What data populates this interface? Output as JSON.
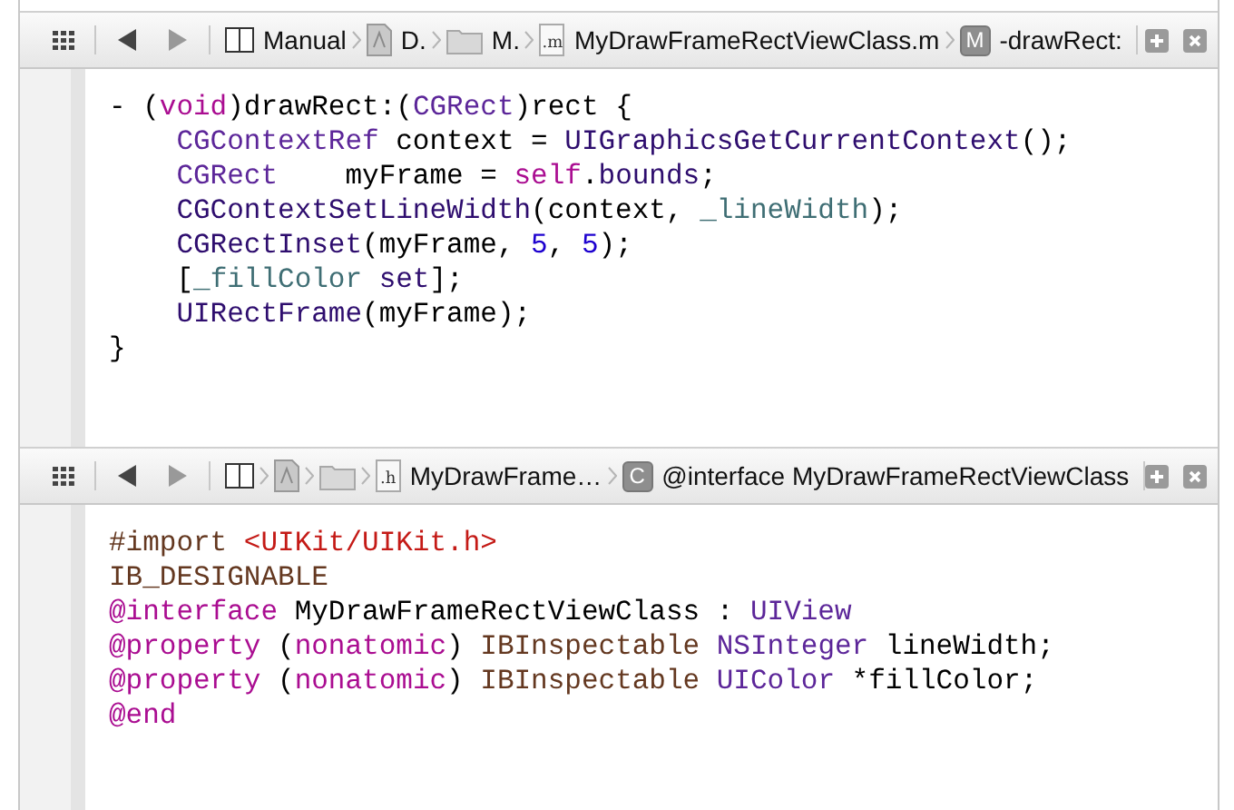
{
  "panes": [
    {
      "jump_bar": {
        "crumbs": [
          {
            "kind": "layout",
            "label": "Manual"
          },
          {
            "kind": "project",
            "label": "D."
          },
          {
            "kind": "folder",
            "label": "M."
          },
          {
            "kind": "file",
            "badge": ".m",
            "label": "MyDrawFrameRectViewClass.m"
          },
          {
            "kind": "symbol",
            "badge": "M",
            "label": "-drawRect:"
          }
        ]
      },
      "code": [
        [
          {
            "kind": "plain",
            "text": "- ("
          },
          {
            "kind": "keyword",
            "text": "void"
          },
          {
            "kind": "plain",
            "text": ")drawRect:("
          },
          {
            "kind": "type",
            "text": "CGRect"
          },
          {
            "kind": "plain",
            "text": ")rect {"
          }
        ],
        [
          {
            "kind": "type",
            "text": "    CGContextRef"
          },
          {
            "kind": "plain",
            "text": " context = "
          },
          {
            "kind": "func",
            "text": "UIGraphicsGetCurrentContext"
          },
          {
            "kind": "plain",
            "text": "();"
          }
        ],
        [
          {
            "kind": "type",
            "text": "    CGRect"
          },
          {
            "kind": "plain",
            "text": "    myFrame = "
          },
          {
            "kind": "keyword",
            "text": "self"
          },
          {
            "kind": "plain",
            "text": "."
          },
          {
            "kind": "func",
            "text": "bounds"
          },
          {
            "kind": "plain",
            "text": ";"
          }
        ],
        [
          {
            "kind": "func",
            "text": "    CGContextSetLineWidth"
          },
          {
            "kind": "plain",
            "text": "(context, "
          },
          {
            "kind": "ivar",
            "text": "_lineWidth"
          },
          {
            "kind": "plain",
            "text": ");"
          }
        ],
        [
          {
            "kind": "func",
            "text": "    CGRectInset"
          },
          {
            "kind": "plain",
            "text": "(myFrame, "
          },
          {
            "kind": "number",
            "text": "5"
          },
          {
            "kind": "plain",
            "text": ", "
          },
          {
            "kind": "number",
            "text": "5"
          },
          {
            "kind": "plain",
            "text": ");"
          }
        ],
        [
          {
            "kind": "plain",
            "text": "    ["
          },
          {
            "kind": "ivar",
            "text": "_fillColor"
          },
          {
            "kind": "func",
            "text": " set"
          },
          {
            "kind": "plain",
            "text": "];"
          }
        ],
        [
          {
            "kind": "func",
            "text": "    UIRectFrame"
          },
          {
            "kind": "plain",
            "text": "(myFrame);"
          }
        ],
        [
          {
            "kind": "plain",
            "text": "}"
          }
        ]
      ]
    },
    {
      "jump_bar": {
        "crumbs": [
          {
            "kind": "layout"
          },
          {
            "kind": "project"
          },
          {
            "kind": "folder"
          },
          {
            "kind": "file",
            "badge": ".h",
            "label": "MyDrawFrame…"
          },
          {
            "kind": "symbol",
            "badge": "C",
            "label": "@interface MyDrawFrameRectViewClass"
          }
        ]
      },
      "code": [
        [
          {
            "kind": "macro",
            "text": "#import "
          },
          {
            "kind": "string",
            "text": "<UIKit/UIKit.h>"
          }
        ],
        [
          {
            "kind": "macro",
            "text": "IB_DESIGNABLE"
          }
        ],
        [
          {
            "kind": "keyword",
            "text": "@interface"
          },
          {
            "kind": "plain",
            "text": " MyDrawFrameRectViewClass : "
          },
          {
            "kind": "type",
            "text": "UIView"
          }
        ],
        [
          {
            "kind": "keyword",
            "text": "@property"
          },
          {
            "kind": "plain",
            "text": " ("
          },
          {
            "kind": "keyword",
            "text": "nonatomic"
          },
          {
            "kind": "plain",
            "text": ") "
          },
          {
            "kind": "macro",
            "text": "IBInspectable"
          },
          {
            "kind": "type",
            "text": " NSInteger"
          },
          {
            "kind": "plain",
            "text": " lineWidth;"
          }
        ],
        [
          {
            "kind": "keyword",
            "text": "@property"
          },
          {
            "kind": "plain",
            "text": " ("
          },
          {
            "kind": "keyword",
            "text": "nonatomic"
          },
          {
            "kind": "plain",
            "text": ") "
          },
          {
            "kind": "macro",
            "text": "IBInspectable"
          },
          {
            "kind": "type",
            "text": " UIColor"
          },
          {
            "kind": "plain",
            "text": " *fillColor;"
          }
        ],
        [
          {
            "kind": "keyword",
            "text": "@end"
          }
        ]
      ]
    }
  ]
}
